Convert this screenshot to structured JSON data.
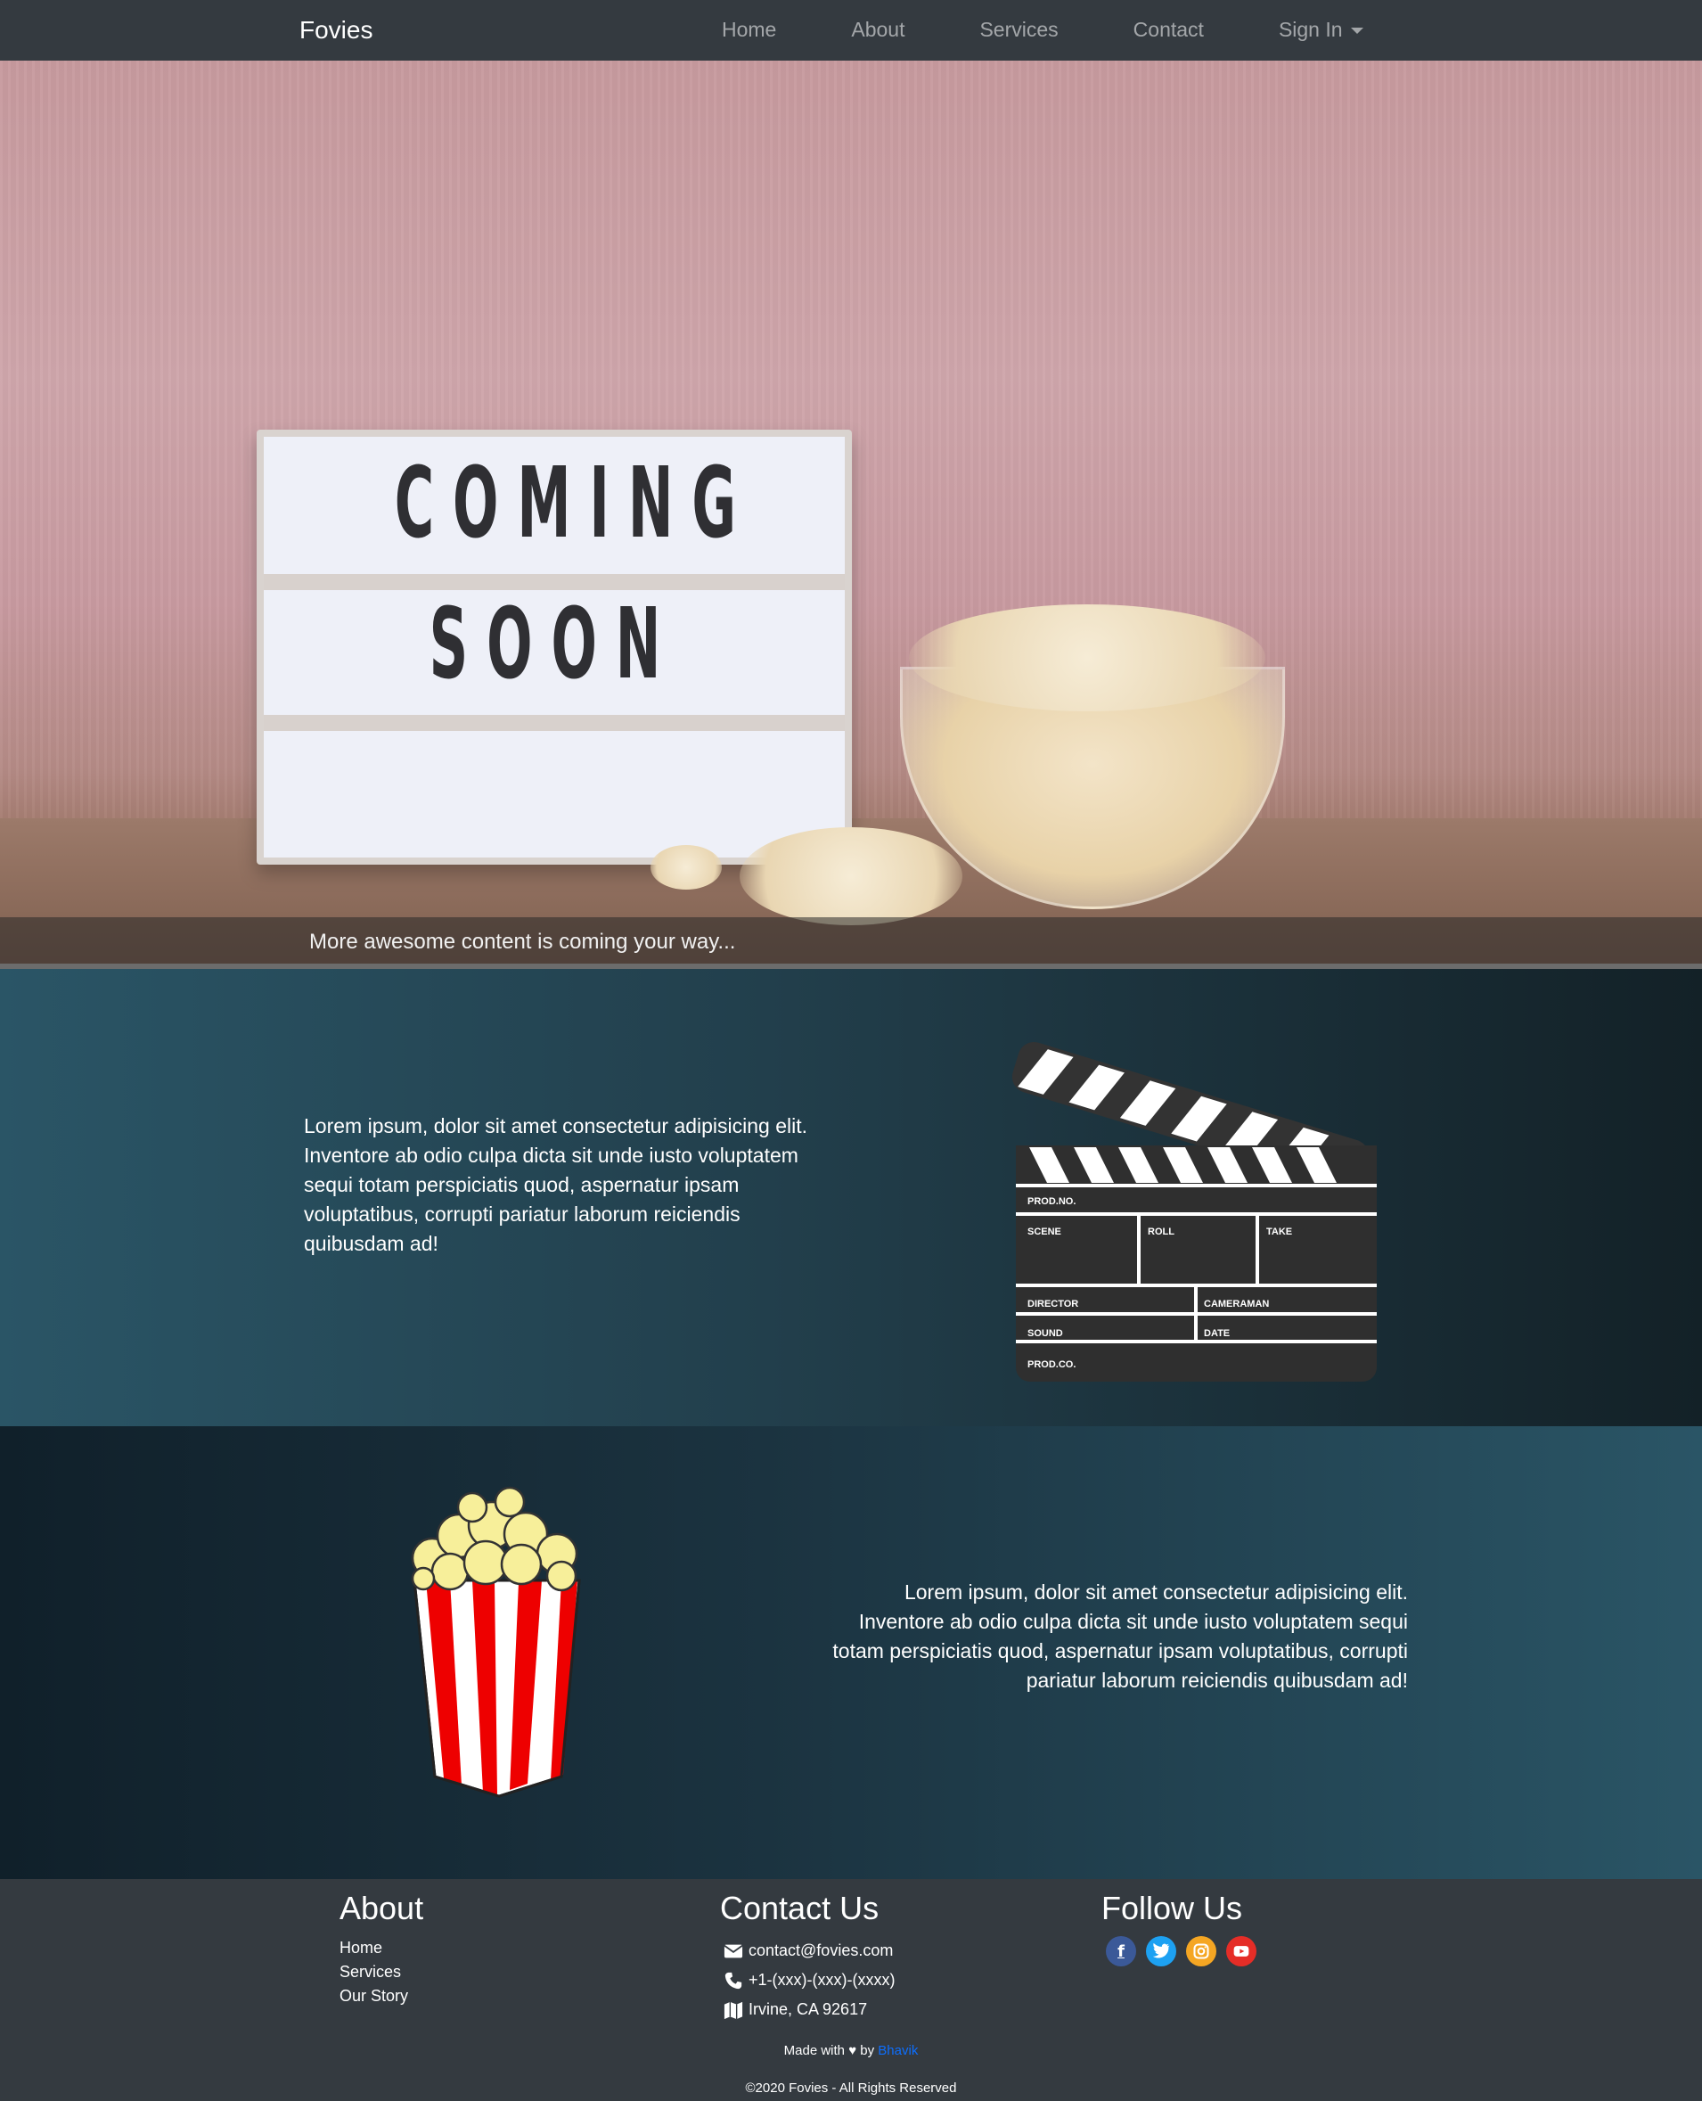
{
  "navbar": {
    "brand": "Fovies",
    "links": [
      "Home",
      "About",
      "Services",
      "Contact"
    ],
    "signin": "Sign In"
  },
  "hero": {
    "sign_line1": "COMING",
    "sign_line2": "SOON",
    "caption": "More awesome content is coming your way..."
  },
  "section1": {
    "text": "Lorem ipsum, dolor sit amet consectetur adipisicing elit. Inventore ab odio culpa dicta sit unde iusto voluptatem sequi totam perspiciatis quod, aspernatur ipsam voluptatibus, corrupti pariatur laborum reiciendis quibusdam ad!",
    "clapper_labels": [
      "PROD.NO.",
      "SCENE",
      "ROLL",
      "TAKE",
      "DIRECTOR",
      "CAMERAMAN",
      "SOUND",
      "DATE",
      "PROD.CO."
    ]
  },
  "section2": {
    "text": "Lorem ipsum, dolor sit amet consectetur adipisicing elit. Inventore ab odio culpa dicta sit unde iusto voluptatem sequi totam perspiciatis quod, aspernatur ipsam voluptatibus, corrupti pariatur laborum reiciendis quibusdam ad!"
  },
  "footer": {
    "about": {
      "title": "About",
      "links": [
        "Home",
        "Services",
        "Our Story"
      ]
    },
    "contact": {
      "title": "Contact Us",
      "email": "contact@fovies.com",
      "phone": "+1-(xxx)-(xxx)-(xxxx)",
      "address": "Irvine, CA 92617"
    },
    "follow": {
      "title": "Follow Us",
      "icons": [
        "facebook-icon",
        "twitter-icon",
        "instagram-icon",
        "youtube-icon"
      ]
    },
    "made_prefix": "Made with",
    "made_by": "by",
    "author": "Bhavik",
    "copyright": "©2020 Fovies - All Rights Reserved"
  },
  "colors": {
    "navbar": "#343a40",
    "facebook": "#3b5998",
    "twitter": "#1da1f2",
    "instagram": "#f5a623",
    "youtube": "#e52d27",
    "author_link": "#0d6efd"
  }
}
